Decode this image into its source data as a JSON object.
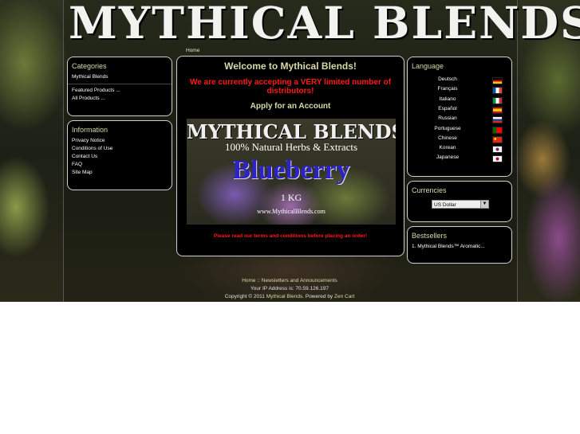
{
  "header": {
    "logo_text": "MYTHICAL BLENDS"
  },
  "breadcrumb": "Home",
  "sidebar_left": {
    "categories": {
      "title": "Categories",
      "items": [
        "Mythical Blends",
        "Featured Products ...",
        "All Products ..."
      ]
    },
    "information": {
      "title": "Information",
      "items": [
        "Privacy Notice",
        "Conditions of Use",
        "Contact Us",
        "FAQ",
        "Site Map"
      ]
    }
  },
  "main": {
    "welcome": "Welcome to Mythical Blends!",
    "notice": "We are currently accepting a VERY limited number of distributors!",
    "apply": "Apply for an Account",
    "banner": {
      "line1": "MYTHICAL BLENDS",
      "line2": "100% Natural Herbs & Extracts",
      "line3": "Blueberry",
      "line4": "1 KG",
      "line5": "www.MythicalBlends.com"
    },
    "terms": "Please read our terms and conditions before placing an order!"
  },
  "sidebar_right": {
    "language": {
      "title": "Language",
      "items": [
        {
          "name": "Deutsch",
          "flag": "german-flag-icon"
        },
        {
          "name": "Français",
          "flag": "french-flag-icon"
        },
        {
          "name": "Italiano",
          "flag": "italian-flag-icon"
        },
        {
          "name": "Español",
          "flag": "spanish-flag-icon"
        },
        {
          "name": "Russian",
          "flag": "russian-flag-icon"
        },
        {
          "name": "Portuguese",
          "flag": "portuguese-flag-icon"
        },
        {
          "name": "Chinese",
          "flag": "chinese-flag-icon"
        },
        {
          "name": "Korean",
          "flag": "korean-flag-icon"
        },
        {
          "name": "Japanese",
          "flag": "japanese-flag-icon"
        }
      ]
    },
    "currencies": {
      "title": "Currencies",
      "selected": "US Dollar"
    },
    "bestsellers": {
      "title": "Bestsellers",
      "items": [
        "1.  Mythical Blends™ Aromatic..."
      ]
    }
  },
  "footer": {
    "nav_home": "Home",
    "nav_sep": "::",
    "nav_news": "Newsletters and Announcements",
    "ip_label": "Your IP Address is: 70.59.126.197",
    "copyright_pre": "Copyright © 2011",
    "copyright_site": "Mythical Blends",
    "powered_pre": ". Powered by",
    "powered_link": "Zen Cart"
  },
  "colors": {
    "accent": "#d9d9a8",
    "alert": "#ff1a1a",
    "box_bg": "#000000",
    "box_border": "#cfcfcf"
  }
}
